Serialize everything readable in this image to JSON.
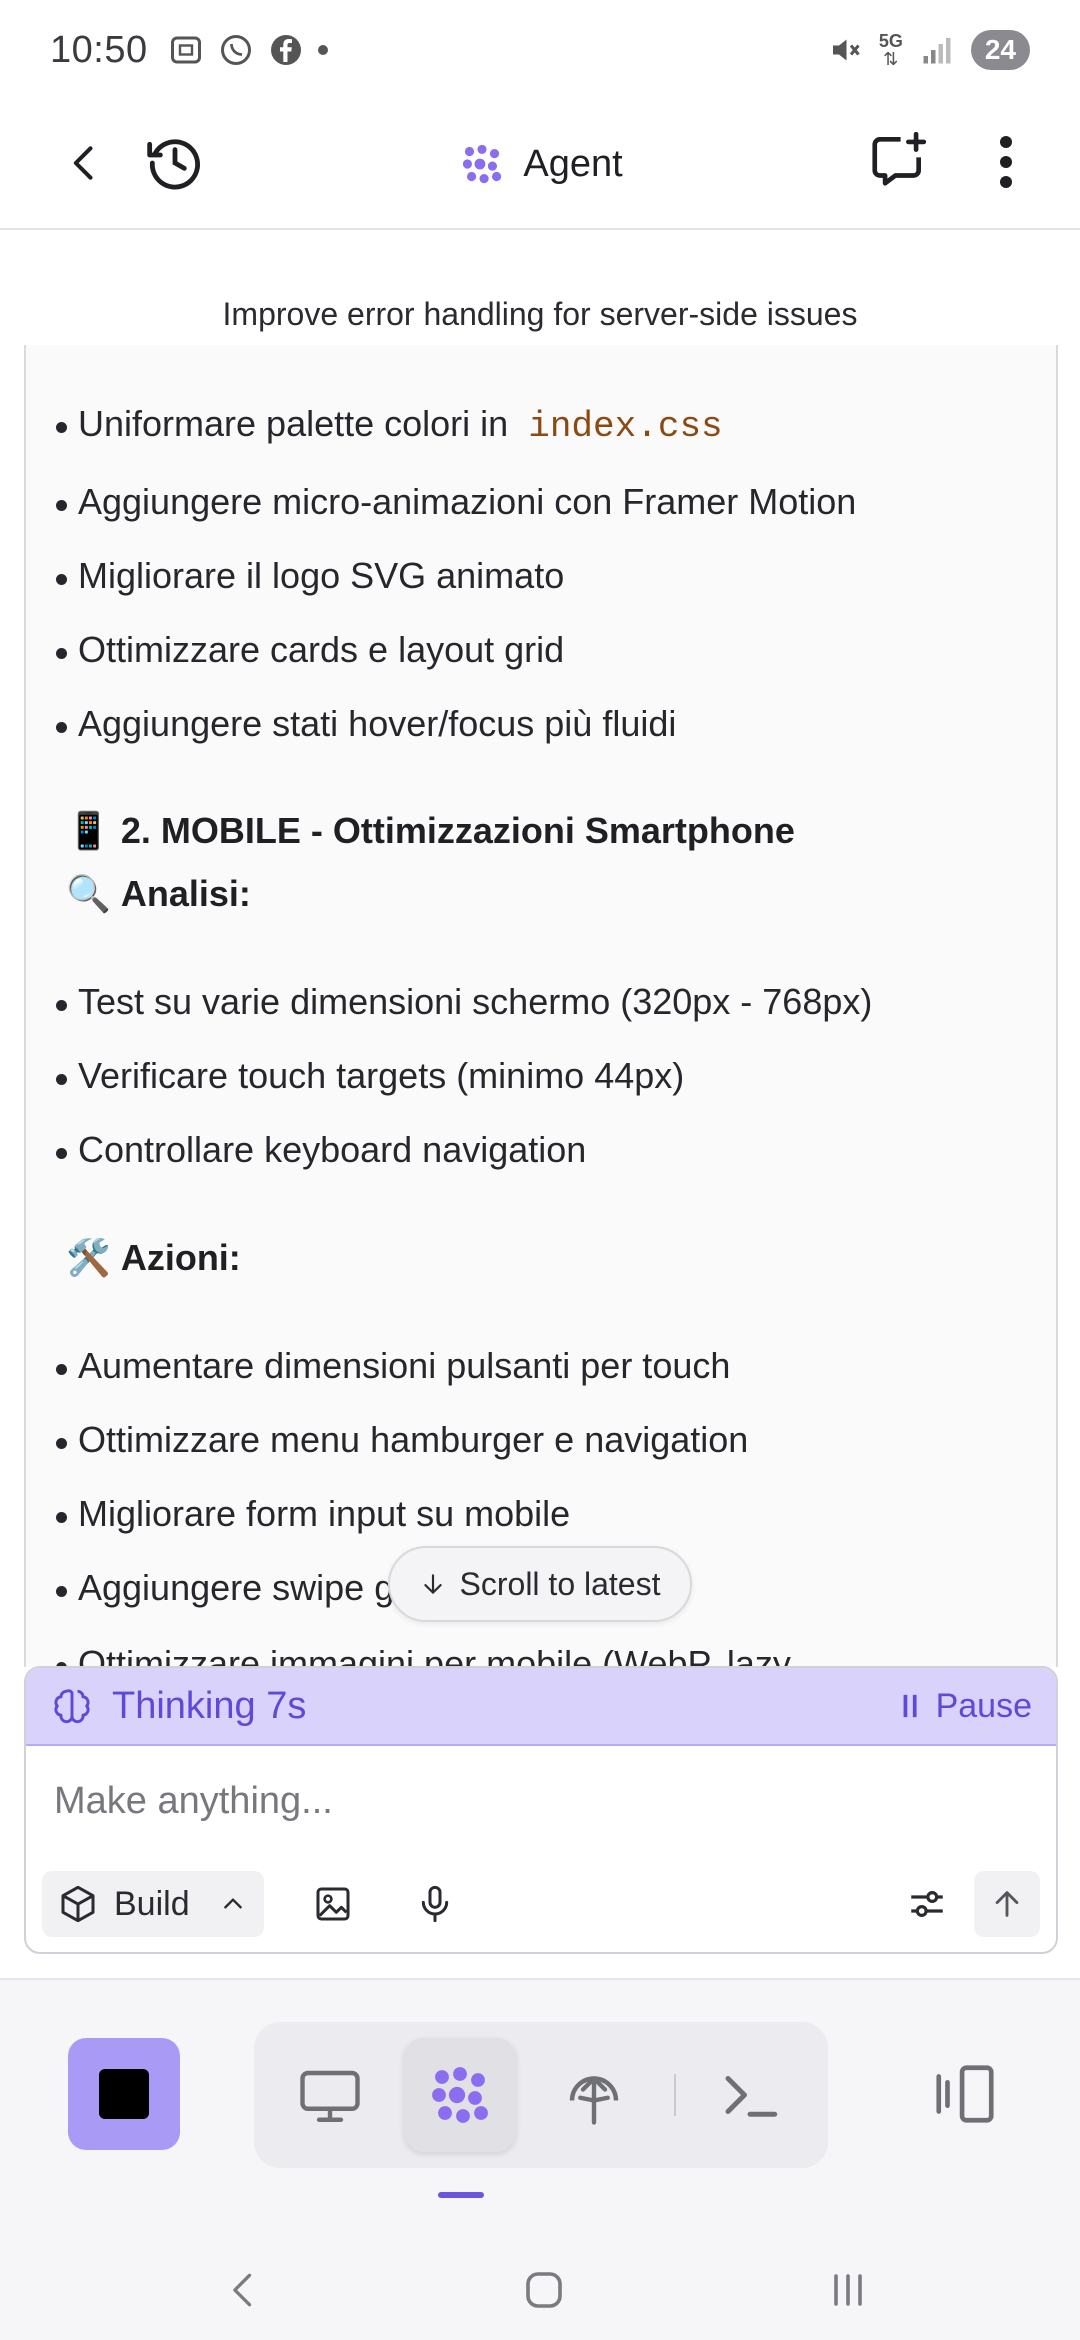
{
  "status_bar": {
    "time": "10:50",
    "network": "5G",
    "battery": "24",
    "icons_left": [
      "screenshot-icon",
      "whatsapp-icon",
      "facebook-icon",
      "dot-icon"
    ],
    "icons_right": [
      "mute-icon",
      "data-arrows-icon",
      "signal-icon",
      "battery-icon"
    ]
  },
  "app_bar": {
    "title": "Agent",
    "icons": [
      "back-arrow-icon",
      "history-icon",
      "agent-logo-icon",
      "new-chat-icon",
      "more-vert-icon"
    ]
  },
  "chat": {
    "subtitle": "Improve error handling for server-side issues",
    "bullets_group1": [
      {
        "text": "Uniformare palette colori in",
        "code": "index.css"
      },
      {
        "text": "Aggiungere micro-animazioni con Framer Motion"
      },
      {
        "text": "Migliorare il logo SVG animato"
      },
      {
        "text": "Ottimizzare cards e layout grid"
      },
      {
        "text": "Aggiungere stati hover/focus più fluidi"
      }
    ],
    "heading_mobile": {
      "emoji": "📱",
      "text": "2. MOBILE - Ottimizzazioni Smartphone"
    },
    "heading_analisi": {
      "emoji": "🔍",
      "text": "Analisi:"
    },
    "bullets_group2": [
      "Test su varie dimensioni schermo (320px - 768px)",
      "Verificare touch targets (minimo 44px)",
      "Controllare keyboard navigation"
    ],
    "heading_azioni": {
      "emoji": "🛠️",
      "text": "Azioni:"
    },
    "bullets_group3": [
      "Aumentare dimensioni pulsanti per touch",
      "Ottimizzare menu hamburger e navigation",
      "Migliorare form input su mobile",
      "Aggiungere swipe gestures dove utile",
      "Ottimizzare immagini per mobile (WebP, lazy"
    ],
    "scroll_to_latest": "Scroll to latest"
  },
  "composer": {
    "thinking_label": "Thinking 7s",
    "pause_label": "Pause",
    "placeholder": "Make anything...",
    "mode_label": "Build",
    "icons": [
      "brain-icon",
      "pause-icon",
      "cube-icon",
      "chevron-up-icon",
      "image-icon",
      "mic-icon",
      "sliders-icon",
      "send-arrow-icon"
    ]
  },
  "bottom_toolbar": {
    "tabs": [
      "monitor-icon",
      "agent-logo-icon",
      "deploy-icon",
      "terminal-icon"
    ],
    "active_tab": "agent-logo-icon"
  },
  "colors": {
    "accent": "#6a55e0",
    "thinking_bg": "#d9d2fb",
    "stop_bg": "#a99af5",
    "code_text": "#8a4a12"
  }
}
